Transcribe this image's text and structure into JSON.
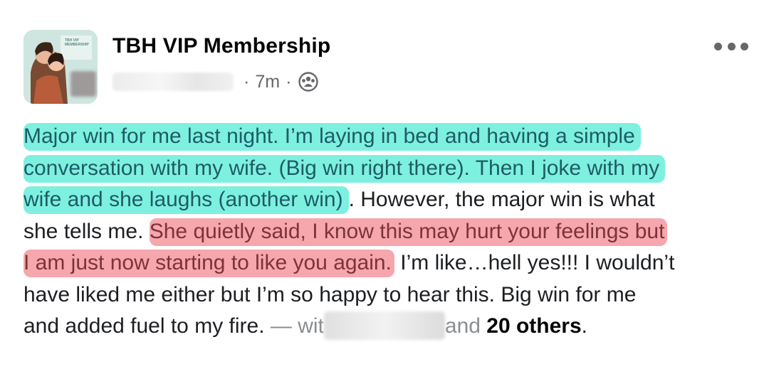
{
  "header": {
    "group_name": "TBH VIP Membership",
    "time": "7m",
    "separator": "·",
    "audience_icon": "group-icon",
    "more_icon": "more-horizontal-icon"
  },
  "avatar": {
    "thumbnail_lines": [
      "TBH VIP",
      "MEMBERSHIP"
    ]
  },
  "post": {
    "line1": "Major win for me last night. I’m laying in bed and having a simple",
    "line2": "conversation with my wife. (Big win right there). Then I joke with my",
    "line3_hl": "wife and she laughs (another win)",
    "line3_rest": ". However, the major win is what",
    "line4_plain": "she tells me. ",
    "line4_hl": "She quietly said, I know this may hurt your feelings but",
    "line5_hl": "I am just now starting to like you again.",
    "line5_rest": " I’m like…hell yes!!! I wouldn’t",
    "line6": "have liked me either but I’m so happy to hear this. Big win for me",
    "line7_start": "and added fuel to my fire.",
    "line7_with": " — wit",
    "line7_and": "and ",
    "line7_others": "20 others",
    "line7_end": "."
  },
  "colors": {
    "highlight_blue": "#7ef0e0",
    "highlight_red": "#f6a6ad",
    "meta_gray": "#65676b"
  }
}
